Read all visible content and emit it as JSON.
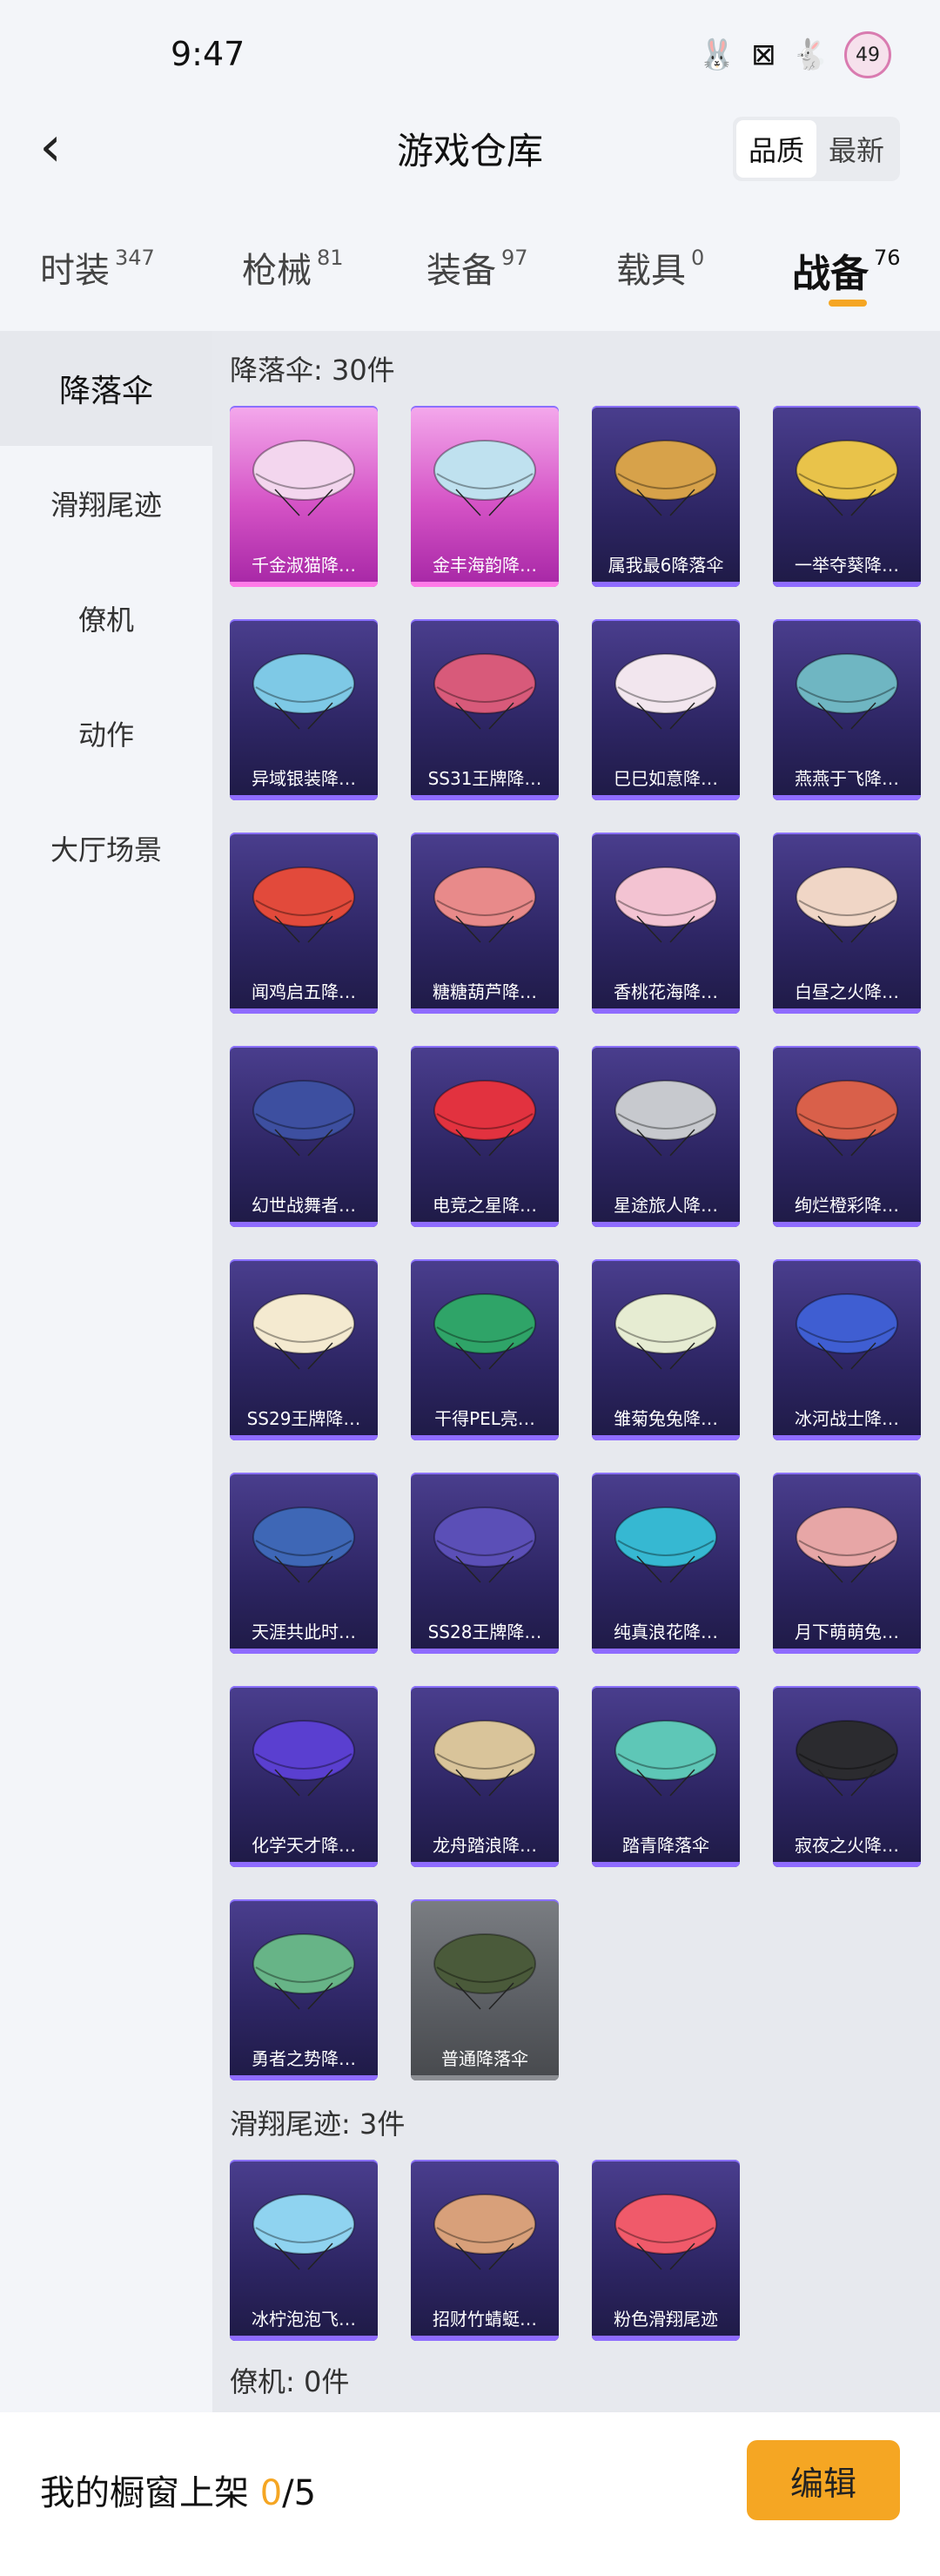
{
  "status": {
    "time": "9:47",
    "battery": "49"
  },
  "header": {
    "title": "游戏仓库",
    "sort_quality": "品质",
    "sort_newest": "最新"
  },
  "categories": [
    {
      "name": "时装",
      "count": "347"
    },
    {
      "name": "枪械",
      "count": "81"
    },
    {
      "name": "装备",
      "count": "97"
    },
    {
      "name": "载具",
      "count": "0"
    },
    {
      "name": "战备",
      "count": "76"
    }
  ],
  "sidebar": [
    "降落伞",
    "滑翔尾迹",
    "僚机",
    "动作",
    "大厅场景"
  ],
  "sections": {
    "parachute_title": "降落伞: 30件",
    "trail_title": "滑翔尾迹: 3件",
    "wingman_title": "僚机: 0件"
  },
  "parachutes": [
    {
      "label": "千金淑猫降…",
      "style": "pink",
      "color": "#f3d6ee"
    },
    {
      "label": "金丰海韵降…",
      "style": "pink",
      "color": "#bfe1ef"
    },
    {
      "label": "属我最6降落伞",
      "style": "purple",
      "color": "#d7a24a"
    },
    {
      "label": "一举夺葵降…",
      "style": "purple",
      "color": "#e9c34a"
    },
    {
      "label": "异域银装降…",
      "style": "purple",
      "color": "#7ec9e6"
    },
    {
      "label": "SS31王牌降…",
      "style": "purple",
      "color": "#d85a7a"
    },
    {
      "label": "巳巳如意降…",
      "style": "purple",
      "color": "#f2e6ee"
    },
    {
      "label": "燕燕于飞降…",
      "style": "purple",
      "color": "#6fb6c2"
    },
    {
      "label": "闻鸡启五降…",
      "style": "purple",
      "color": "#e24a3b"
    },
    {
      "label": "糖糖葫芦降…",
      "style": "purple",
      "color": "#e88a8a"
    },
    {
      "label": "香桃花海降…",
      "style": "purple",
      "color": "#f3c3d2"
    },
    {
      "label": "白昼之火降…",
      "style": "purple",
      "color": "#f0d6c6"
    },
    {
      "label": "幻世战舞者…",
      "style": "purple",
      "color": "#3d4fa0"
    },
    {
      "label": "电竞之星降…",
      "style": "purple",
      "color": "#e2323f"
    },
    {
      "label": "星途旅人降…",
      "style": "purple",
      "color": "#c7c9ce"
    },
    {
      "label": "绚烂橙彩降…",
      "style": "purple",
      "color": "#d9604a"
    },
    {
      "label": "SS29王牌降…",
      "style": "purple",
      "color": "#f4ead0"
    },
    {
      "label": "干得PEL亮…",
      "style": "purple",
      "color": "#2fa468"
    },
    {
      "label": "雏菊兔兔降…",
      "style": "purple",
      "color": "#e6ecd2"
    },
    {
      "label": "冰河战士降…",
      "style": "purple",
      "color": "#3f5ed2"
    },
    {
      "label": "天涯共此时…",
      "style": "purple",
      "color": "#3e67b6"
    },
    {
      "label": "SS28王牌降…",
      "style": "purple",
      "color": "#5b4fb7"
    },
    {
      "label": "纯真浪花降…",
      "style": "purple",
      "color": "#36b8d2"
    },
    {
      "label": "月下萌萌兔…",
      "style": "purple",
      "color": "#e7a6a6"
    },
    {
      "label": "化学天才降…",
      "style": "purple",
      "color": "#5a3fd0"
    },
    {
      "label": "龙舟踏浪降…",
      "style": "purple",
      "color": "#d9c49a"
    },
    {
      "label": "踏青降落伞",
      "style": "purple",
      "color": "#5ec7b7"
    },
    {
      "label": "寂夜之火降…",
      "style": "purple",
      "color": "#2b2b2f"
    },
    {
      "label": "勇者之势降…",
      "style": "purple",
      "color": "#67b487"
    },
    {
      "label": "普通降落伞",
      "style": "gray",
      "color": "#4a5a3a"
    }
  ],
  "trails": [
    {
      "label": "冰柠泡泡飞…",
      "style": "purple",
      "color": "#8fd3f0"
    },
    {
      "label": "招财竹蜻蜓…",
      "style": "purple",
      "color": "#d8a07a"
    },
    {
      "label": "粉色滑翔尾迹",
      "style": "purple",
      "color": "#f05a6a"
    }
  ],
  "bottom": {
    "prefix": "我的橱窗上架 ",
    "current": "0",
    "suffix": "/5",
    "edit": "编辑"
  }
}
